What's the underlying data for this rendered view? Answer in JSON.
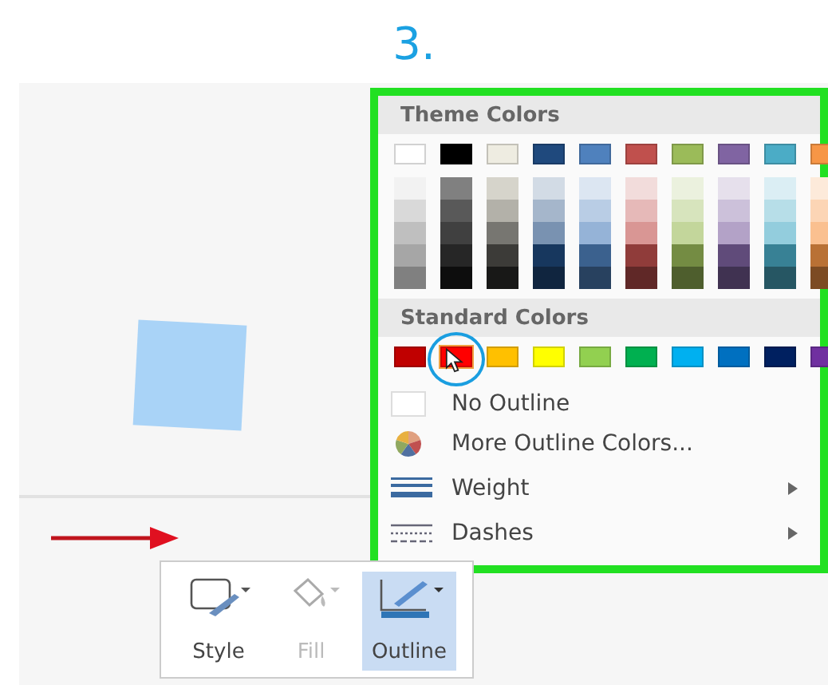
{
  "step_title": "3.",
  "theme_colors": {
    "heading": "Theme Colors",
    "columns": [
      {
        "color": "#ffffff"
      },
      {
        "color": "#000000"
      },
      {
        "color": "#eeece1"
      },
      {
        "color": "#1f497d"
      },
      {
        "color": "#4f81bd"
      },
      {
        "color": "#c0504d"
      },
      {
        "color": "#9bbb59"
      },
      {
        "color": "#8064a2"
      },
      {
        "color": "#4bacc6"
      },
      {
        "color": "#f79646"
      }
    ]
  },
  "standard_colors": {
    "heading": "Standard Colors",
    "swatches": [
      {
        "color": "#c00000",
        "selected": false
      },
      {
        "color": "#ff0000",
        "selected": true
      },
      {
        "color": "#ffc000",
        "selected": false
      },
      {
        "color": "#ffff00",
        "selected": false
      },
      {
        "color": "#92d050",
        "selected": false
      },
      {
        "color": "#00b050",
        "selected": false
      },
      {
        "color": "#00b0f0",
        "selected": false
      },
      {
        "color": "#0070c0",
        "selected": false
      },
      {
        "color": "#002060",
        "selected": false
      },
      {
        "color": "#7030a0",
        "selected": false
      }
    ]
  },
  "menu_items": [
    {
      "kind": "no_outline",
      "label": "No Outline",
      "submenu": false
    },
    {
      "kind": "more_colors",
      "label": "More Outline Colors...",
      "submenu": false
    },
    {
      "kind": "weight",
      "label": "Weight",
      "submenu": true
    },
    {
      "kind": "dashes",
      "label": "Dashes",
      "submenu": true
    }
  ],
  "toolbar": [
    {
      "kind": "style",
      "label": "Style",
      "disabled": false,
      "selected": false
    },
    {
      "kind": "fill",
      "label": "Fill",
      "disabled": true,
      "selected": false
    },
    {
      "kind": "outline",
      "label": "Outline",
      "disabled": false,
      "selected": true
    }
  ]
}
